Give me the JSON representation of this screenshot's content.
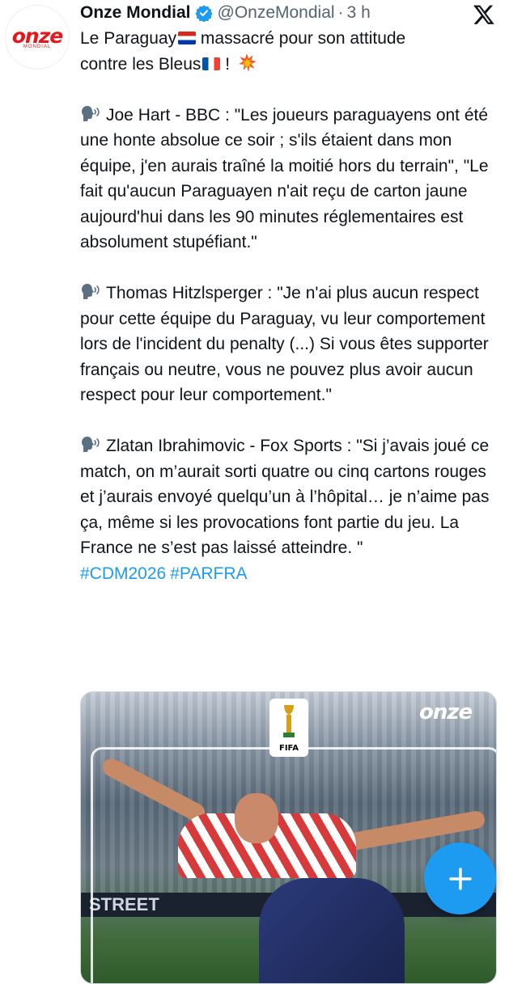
{
  "author": {
    "name": "Onze Mondial",
    "handle": "@OnzeMondial",
    "separator": "·",
    "time": "3 h",
    "avatar_logo": "onze",
    "avatar_logo_sub": "MONDIAL"
  },
  "tweet": {
    "intro_line1": "Le Paraguay",
    "intro_line1_end": " massacré pour son attitude",
    "intro_line2": "contre les Bleus",
    "intro_line2_end": " !",
    "quotes": [
      {
        "icon": "speaking-head-icon",
        "text": "Joe Hart - BBC : \"Les joueurs paraguayens ont été une honte absolue ce soir ; s'ils étaient dans mon équipe, j'en aurais traîné la moitié hors du terrain\", \"Le fait qu'aucun Paraguayen n'ait reçu de carton jaune aujourd'hui dans les 90 minutes réglementaires est absolument stupéfiant.\""
      },
      {
        "icon": "speaking-head-icon",
        "text": "Thomas Hitzlsperger : \"Je n'ai plus aucun respect pour cette équipe du Paraguay, vu leur comportement lors de l'incident du penalty (...) Si vous êtes supporter français ou neutre, vous ne pouvez plus avoir aucun respect pour leur comportement.\""
      },
      {
        "icon": "speaking-head-icon",
        "text": "Zlatan Ibrahimovic - Fox Sports : \"Si j’avais joué ce match, on m’aurait sorti quatre ou cinq cartons rouges et j’aurais envoyé quelqu’un à l’hôpital… je n’aime pas ça, même si les provocations font partie du jeu. La France ne s’est pas laissé atteindre. \""
      }
    ],
    "hashtags": [
      "#CDM2026",
      "#PARFRA"
    ]
  },
  "media": {
    "image_logo": "onze",
    "badge_label": "FIFA",
    "board_text": "STREET"
  },
  "colors": {
    "accent": "#1d9bf0",
    "text": "#0f1419",
    "muted": "#536471",
    "brand_red": "#e2191c"
  },
  "icons": {
    "verified": "verified-badge-icon",
    "x_logo": "x-logo-icon",
    "compose": "plus-icon",
    "explosion": "collision-emoji-icon"
  }
}
